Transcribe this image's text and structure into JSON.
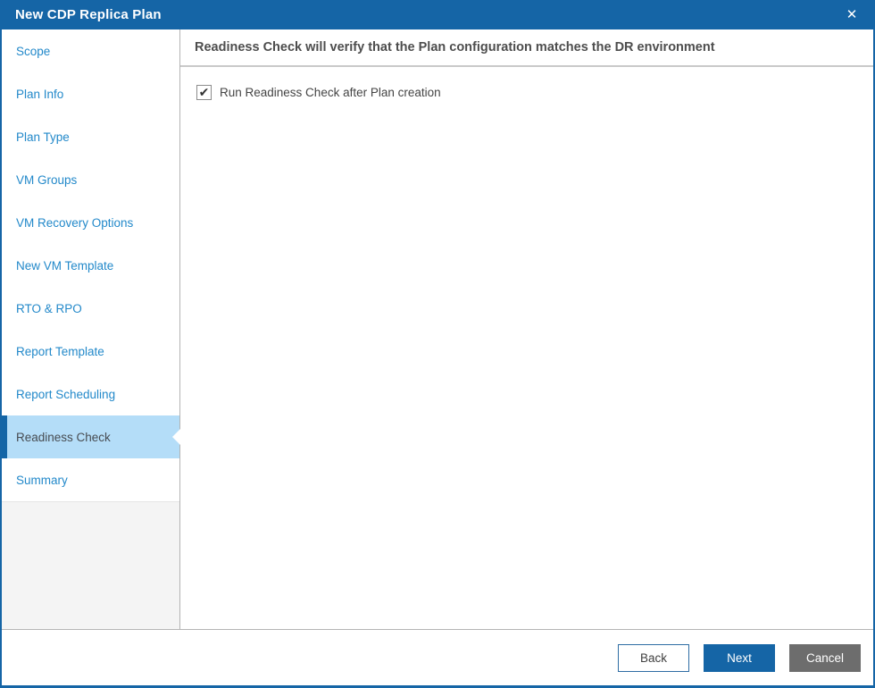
{
  "window": {
    "title": "New CDP Replica Plan",
    "close_glyph": "✕"
  },
  "appearance": {
    "titlebar_color": "#1565a6",
    "accent_blue": "#1565a6",
    "sidebar_link_color": "#2389ca",
    "active_step_bg": "#b4ddf8",
    "active_step_bar": "#1465a6",
    "cancel_button_gray": "#6d6d6d",
    "divider_gray": "#b3b3b3"
  },
  "sidebar": {
    "items": [
      {
        "label": "Scope",
        "active": false
      },
      {
        "label": "Plan Info",
        "active": false
      },
      {
        "label": "Plan Type",
        "active": false
      },
      {
        "label": "VM Groups",
        "active": false
      },
      {
        "label": "VM Recovery Options",
        "active": false
      },
      {
        "label": "New VM Template",
        "active": false
      },
      {
        "label": "RTO & RPO",
        "active": false
      },
      {
        "label": "Report Template",
        "active": false
      },
      {
        "label": "Report Scheduling",
        "active": false
      },
      {
        "label": "Readiness Check",
        "active": true
      },
      {
        "label": "Summary",
        "active": false
      }
    ]
  },
  "content": {
    "header": "Readiness Check will verify that the Plan configuration matches the DR environment",
    "checkbox": {
      "label": "Run Readiness Check after Plan creation",
      "checked": true,
      "check_glyph": "✔"
    }
  },
  "footer": {
    "back_label": "Back",
    "next_label": "Next",
    "cancel_label": "Cancel"
  }
}
